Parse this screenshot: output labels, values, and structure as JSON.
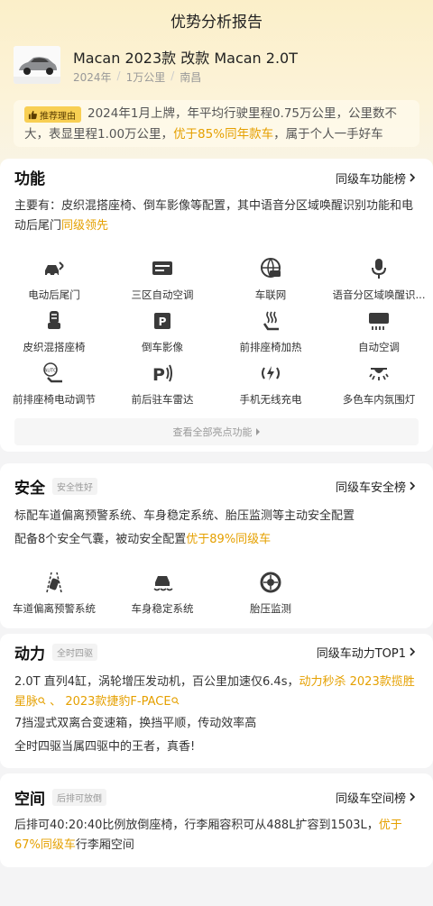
{
  "header": {
    "title": "优势分析报告"
  },
  "car": {
    "name": "Macan 2023款 改款 Macan 2.0T",
    "year": "2024年",
    "mileage": "1万公里",
    "city": "南昌"
  },
  "recommend": {
    "tag": "推荐理由",
    "text_before": "2024年1月上牌，年平均行驶里程0.75万公里，公里数不大，表显里程1.00万公里，",
    "highlight": "优于85%同年款车",
    "text_after": "，属于个人一手好车"
  },
  "function": {
    "title": "功能",
    "rank": "同级车功能榜",
    "desc_before": "主要有：皮织混搭座椅、倒车影像等配置，其中语音分区域唤醒识别功能和电动后尾门",
    "desc_highlight": "同级领先",
    "features": [
      {
        "label": "电动后尾门",
        "icon": "tailgate-icon"
      },
      {
        "label": "三区自动空调",
        "icon": "ac-icon"
      },
      {
        "label": "车联网",
        "icon": "connected-car-icon"
      },
      {
        "label": "语音分区域唤醒识...",
        "icon": "microphone-icon"
      },
      {
        "label": "皮织混搭座椅",
        "icon": "seat-icon"
      },
      {
        "label": "倒车影像",
        "icon": "reverse-camera-icon"
      },
      {
        "label": "前排座椅加热",
        "icon": "seat-heat-icon"
      },
      {
        "label": "自动空调",
        "icon": "auto-ac-icon"
      },
      {
        "label": "前排座椅电动调节",
        "icon": "auto-seat-icon"
      },
      {
        "label": "前后驻车雷达",
        "icon": "parking-radar-icon"
      },
      {
        "label": "手机无线充电",
        "icon": "wireless-charge-icon"
      },
      {
        "label": "多色车内氛围灯",
        "icon": "ambient-light-icon"
      }
    ],
    "view_all": "查看全部亮点功能"
  },
  "safety": {
    "title": "安全",
    "badge": "安全性好",
    "rank": "同级车安全榜",
    "line1": "标配车道偏离预警系统、车身稳定系统、胎压监测等主动安全配置",
    "line2_before": "配备8个安全气囊，被动安全配置",
    "line2_highlight": "优于89%同级车",
    "features": [
      {
        "label": "车道偏离预警系统",
        "icon": "lane-departure-icon"
      },
      {
        "label": "车身稳定系统",
        "icon": "stability-icon"
      },
      {
        "label": "胎压监测",
        "icon": "tire-pressure-icon"
      }
    ]
  },
  "power": {
    "title": "动力",
    "badge": "全时四驱",
    "rank": "同级车动力TOP1",
    "line1_before": "2.0T 直列4缸，涡轮增压发动机，百公里加速仅6.4s，",
    "line1_highlight": "动力秒杀",
    "compare1": "2023款揽胜星脉",
    "compare_sep": "、",
    "compare2": "2023款捷豹F-PACE",
    "line2": "7挡湿式双离合变速箱，换挡平顺，传动效率高",
    "line3": "全时四驱当属四驱中的王者，真香!"
  },
  "space": {
    "title": "空间",
    "badge": "后排可放倒",
    "rank": "同级车空间榜",
    "desc_before": "后排可40:20:40比例放倒座椅，行李厢容积可从488L扩容到1503L，",
    "desc_highlight": "优于67%同级车",
    "desc_after": "行李厢空间"
  },
  "colors": {
    "accent": "#e5a000",
    "tag_bg": "#f8cf53",
    "header_bg": "#fbefc9"
  }
}
